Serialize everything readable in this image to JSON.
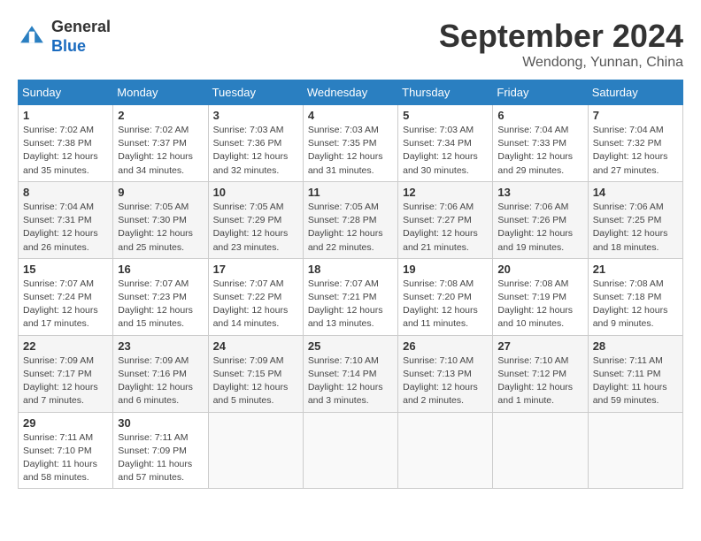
{
  "header": {
    "logo_general": "General",
    "logo_blue": "Blue",
    "title": "September 2024",
    "location": "Wendong, Yunnan, China"
  },
  "weekdays": [
    "Sunday",
    "Monday",
    "Tuesday",
    "Wednesday",
    "Thursday",
    "Friday",
    "Saturday"
  ],
  "weeks": [
    [
      {
        "day": 1,
        "info": "Sunrise: 7:02 AM\nSunset: 7:38 PM\nDaylight: 12 hours\nand 35 minutes."
      },
      {
        "day": 2,
        "info": "Sunrise: 7:02 AM\nSunset: 7:37 PM\nDaylight: 12 hours\nand 34 minutes."
      },
      {
        "day": 3,
        "info": "Sunrise: 7:03 AM\nSunset: 7:36 PM\nDaylight: 12 hours\nand 32 minutes."
      },
      {
        "day": 4,
        "info": "Sunrise: 7:03 AM\nSunset: 7:35 PM\nDaylight: 12 hours\nand 31 minutes."
      },
      {
        "day": 5,
        "info": "Sunrise: 7:03 AM\nSunset: 7:34 PM\nDaylight: 12 hours\nand 30 minutes."
      },
      {
        "day": 6,
        "info": "Sunrise: 7:04 AM\nSunset: 7:33 PM\nDaylight: 12 hours\nand 29 minutes."
      },
      {
        "day": 7,
        "info": "Sunrise: 7:04 AM\nSunset: 7:32 PM\nDaylight: 12 hours\nand 27 minutes."
      }
    ],
    [
      {
        "day": 8,
        "info": "Sunrise: 7:04 AM\nSunset: 7:31 PM\nDaylight: 12 hours\nand 26 minutes."
      },
      {
        "day": 9,
        "info": "Sunrise: 7:05 AM\nSunset: 7:30 PM\nDaylight: 12 hours\nand 25 minutes."
      },
      {
        "day": 10,
        "info": "Sunrise: 7:05 AM\nSunset: 7:29 PM\nDaylight: 12 hours\nand 23 minutes."
      },
      {
        "day": 11,
        "info": "Sunrise: 7:05 AM\nSunset: 7:28 PM\nDaylight: 12 hours\nand 22 minutes."
      },
      {
        "day": 12,
        "info": "Sunrise: 7:06 AM\nSunset: 7:27 PM\nDaylight: 12 hours\nand 21 minutes."
      },
      {
        "day": 13,
        "info": "Sunrise: 7:06 AM\nSunset: 7:26 PM\nDaylight: 12 hours\nand 19 minutes."
      },
      {
        "day": 14,
        "info": "Sunrise: 7:06 AM\nSunset: 7:25 PM\nDaylight: 12 hours\nand 18 minutes."
      }
    ],
    [
      {
        "day": 15,
        "info": "Sunrise: 7:07 AM\nSunset: 7:24 PM\nDaylight: 12 hours\nand 17 minutes."
      },
      {
        "day": 16,
        "info": "Sunrise: 7:07 AM\nSunset: 7:23 PM\nDaylight: 12 hours\nand 15 minutes."
      },
      {
        "day": 17,
        "info": "Sunrise: 7:07 AM\nSunset: 7:22 PM\nDaylight: 12 hours\nand 14 minutes."
      },
      {
        "day": 18,
        "info": "Sunrise: 7:07 AM\nSunset: 7:21 PM\nDaylight: 12 hours\nand 13 minutes."
      },
      {
        "day": 19,
        "info": "Sunrise: 7:08 AM\nSunset: 7:20 PM\nDaylight: 12 hours\nand 11 minutes."
      },
      {
        "day": 20,
        "info": "Sunrise: 7:08 AM\nSunset: 7:19 PM\nDaylight: 12 hours\nand 10 minutes."
      },
      {
        "day": 21,
        "info": "Sunrise: 7:08 AM\nSunset: 7:18 PM\nDaylight: 12 hours\nand 9 minutes."
      }
    ],
    [
      {
        "day": 22,
        "info": "Sunrise: 7:09 AM\nSunset: 7:17 PM\nDaylight: 12 hours\nand 7 minutes."
      },
      {
        "day": 23,
        "info": "Sunrise: 7:09 AM\nSunset: 7:16 PM\nDaylight: 12 hours\nand 6 minutes."
      },
      {
        "day": 24,
        "info": "Sunrise: 7:09 AM\nSunset: 7:15 PM\nDaylight: 12 hours\nand 5 minutes."
      },
      {
        "day": 25,
        "info": "Sunrise: 7:10 AM\nSunset: 7:14 PM\nDaylight: 12 hours\nand 3 minutes."
      },
      {
        "day": 26,
        "info": "Sunrise: 7:10 AM\nSunset: 7:13 PM\nDaylight: 12 hours\nand 2 minutes."
      },
      {
        "day": 27,
        "info": "Sunrise: 7:10 AM\nSunset: 7:12 PM\nDaylight: 12 hours\nand 1 minute."
      },
      {
        "day": 28,
        "info": "Sunrise: 7:11 AM\nSunset: 7:11 PM\nDaylight: 11 hours\nand 59 minutes."
      }
    ],
    [
      {
        "day": 29,
        "info": "Sunrise: 7:11 AM\nSunset: 7:10 PM\nDaylight: 11 hours\nand 58 minutes."
      },
      {
        "day": 30,
        "info": "Sunrise: 7:11 AM\nSunset: 7:09 PM\nDaylight: 11 hours\nand 57 minutes."
      },
      null,
      null,
      null,
      null,
      null
    ]
  ]
}
